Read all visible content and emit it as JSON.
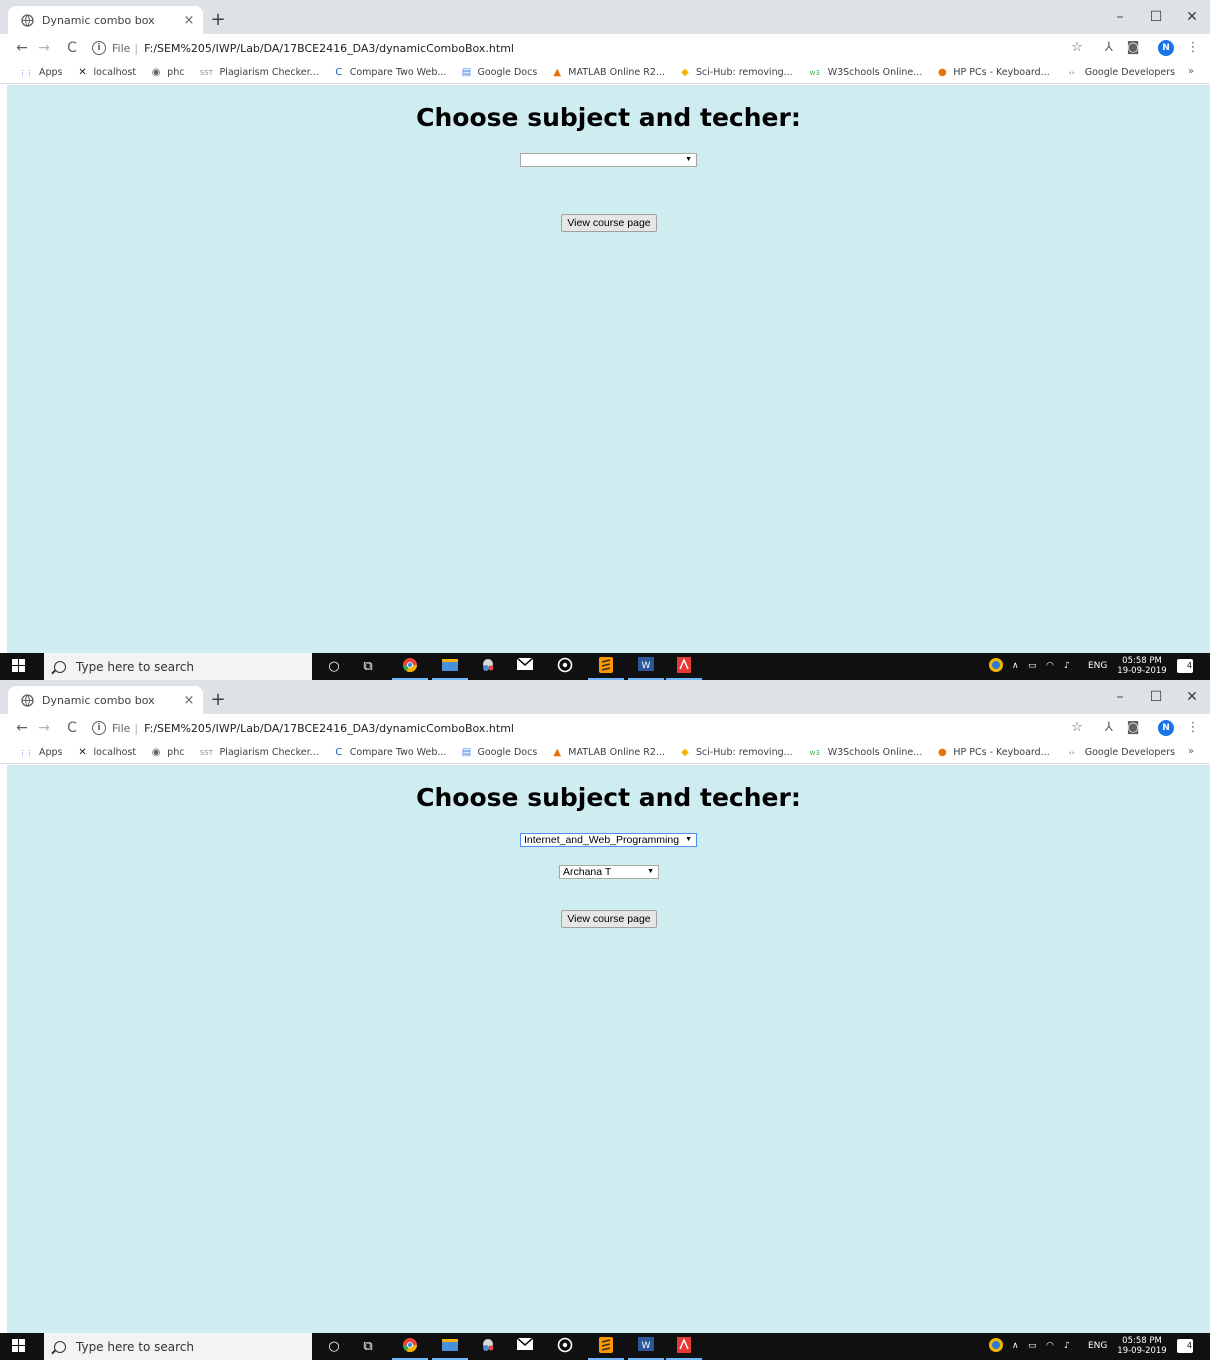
{
  "browser": {
    "tab_title": "Dynamic combo box",
    "tab_close": "×",
    "new_tab": "+",
    "win_min": "–",
    "win_max": "☐",
    "win_close": "✕",
    "nav_back": "←",
    "nav_forward": "→",
    "nav_reload": "C",
    "omni_info": "i",
    "url_label": "File",
    "url_separator": "|",
    "url": "F:/SEM%205/IWP/Lab/DA/17BCE2416_DA3/dynamicComboBox.html",
    "star": "☆",
    "acrobat": "⅄",
    "camera": "◙",
    "avatar": "N",
    "menu": "⋮",
    "bookmarks": [
      {
        "label": "Apps",
        "icon": "apps-grid-icon",
        "glyph": "⋮⋮",
        "color": "#1a73e8"
      },
      {
        "label": "localhost",
        "icon": "tools-icon",
        "glyph": "✕",
        "color": "#202124"
      },
      {
        "label": "phc",
        "icon": "globe-icon",
        "glyph": "◉",
        "color": "#5f6368"
      },
      {
        "label": "Plagiarism Checker...",
        "icon": "sst-icon",
        "glyph": "SST",
        "color": "#8a8a8a"
      },
      {
        "label": "Compare Two Web...",
        "icon": "c-logo-icon",
        "glyph": "C",
        "color": "#1a5fb4"
      },
      {
        "label": "Google Docs",
        "icon": "docs-icon",
        "glyph": "▤",
        "color": "#4285f4"
      },
      {
        "label": "MATLAB Online R2...",
        "icon": "matlab-icon",
        "glyph": "▲",
        "color": "#e8710a"
      },
      {
        "label": "Sci-Hub: removing...",
        "icon": "scihub-icon",
        "glyph": "◆",
        "color": "#f4b400"
      },
      {
        "label": "W3Schools Online...",
        "icon": "w3schools-icon",
        "glyph": "w3",
        "color": "#4caf50"
      },
      {
        "label": "HP PCs - Keyboard...",
        "icon": "hp-icon",
        "glyph": "●",
        "color": "#e8710a"
      },
      {
        "label": "Google Developers",
        "icon": "developers-icon",
        "glyph": "‹›",
        "color": "#5f6368"
      }
    ],
    "bookmarks_more": "»"
  },
  "page": {
    "heading": "Choose subject and techer:",
    "button_label": "View course page"
  },
  "state_empty": {
    "subject_selected": ""
  },
  "state_filled": {
    "subject_selected": "Internet_and_Web_Programming",
    "teacher_selected": "Archana T"
  },
  "taskbar": {
    "search_placeholder": "Type here to search",
    "language": "ENG",
    "time": "05:58 PM",
    "date": "19-09-2019",
    "notifications": "4"
  }
}
